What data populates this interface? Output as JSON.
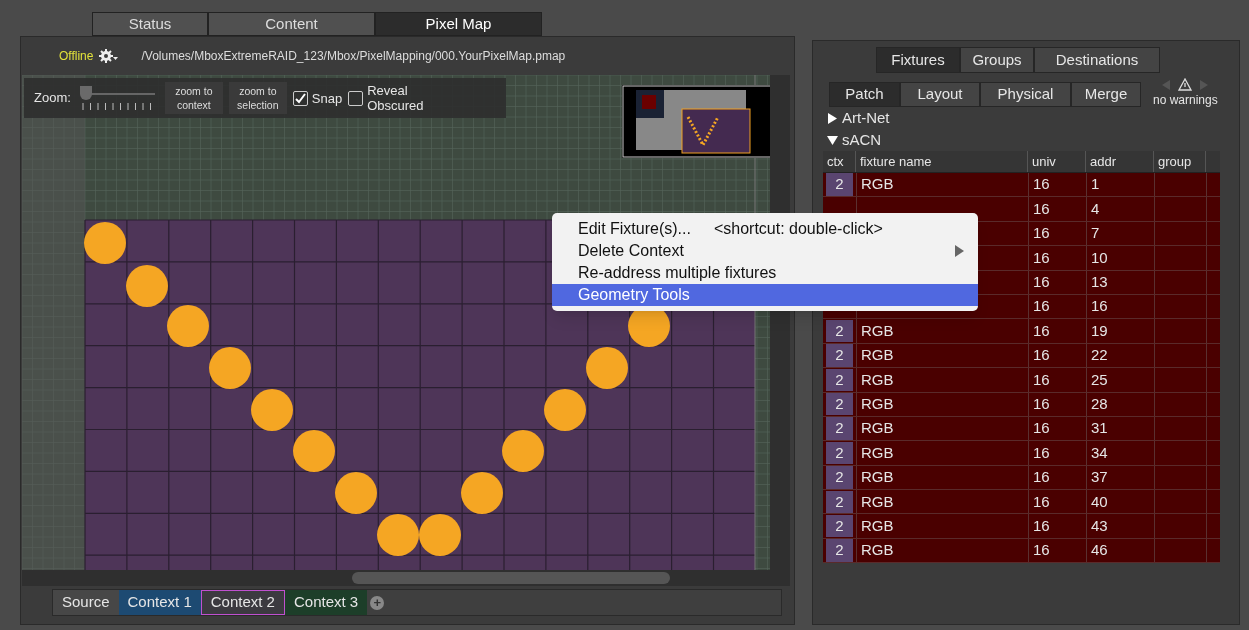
{
  "main_tabs": [
    {
      "label": "Status",
      "selected": false
    },
    {
      "label": "Content",
      "selected": false
    },
    {
      "label": "Pixel Map",
      "selected": true
    }
  ],
  "file_bar": {
    "status": "Offline",
    "path": "/Volumes/MboxExtremeRAID_123/Mbox/PixelMapping/000.YourPixelMap.pmap"
  },
  "zoom_toolbar": {
    "label": "Zoom:",
    "level": 0.05,
    "buttons": [
      "zoom to context",
      "zoom to selection"
    ],
    "checkboxes": [
      {
        "label": "Snap",
        "checked": true
      },
      {
        "label": "Reveal Obscured",
        "checked": false
      }
    ]
  },
  "context_tabs": [
    {
      "label": "Source",
      "color": "#474747",
      "selected": false
    },
    {
      "label": "Context 1",
      "color": "#1d4a72",
      "selected": false
    },
    {
      "label": "Context 2",
      "color": "#3c3a40",
      "selected": true
    },
    {
      "label": "Context 3",
      "color": "#1d3e29",
      "selected": false
    }
  ],
  "add_context_button": "+",
  "panel_tabs": [
    {
      "label": "Fixtures",
      "selected": true
    },
    {
      "label": "Groups",
      "selected": false
    },
    {
      "label": "Destinations",
      "selected": false
    }
  ],
  "sub_tabs": [
    {
      "label": "Patch",
      "selected": true
    },
    {
      "label": "Layout",
      "selected": false
    },
    {
      "label": "Physical",
      "selected": false
    },
    {
      "label": "Merge",
      "selected": false
    }
  ],
  "warnings": {
    "text": "no warnings"
  },
  "protocols": [
    {
      "label": "Art-Net",
      "expanded": false
    },
    {
      "label": "sACN",
      "expanded": true
    }
  ],
  "table": {
    "columns": [
      "ctx",
      "fixture name",
      "univ",
      "addr",
      "group"
    ],
    "rows": [
      {
        "ctx": "2",
        "fixture_name": "RGB",
        "univ": "16",
        "addr": "1"
      },
      {
        "univ": "16",
        "addr": "4"
      },
      {
        "univ": "16",
        "addr": "7"
      },
      {
        "univ": "16",
        "addr": "10"
      },
      {
        "univ": "16",
        "addr": "13"
      },
      {
        "univ": "16",
        "addr": "16"
      },
      {
        "ctx": "2",
        "fixture_name": "RGB",
        "univ": "16",
        "addr": "19"
      },
      {
        "ctx": "2",
        "fixture_name": "RGB",
        "univ": "16",
        "addr": "22"
      },
      {
        "ctx": "2",
        "fixture_name": "RGB",
        "univ": "16",
        "addr": "25"
      },
      {
        "ctx": "2",
        "fixture_name": "RGB",
        "univ": "16",
        "addr": "28"
      },
      {
        "ctx": "2",
        "fixture_name": "RGB",
        "univ": "16",
        "addr": "31"
      },
      {
        "ctx": "2",
        "fixture_name": "RGB",
        "univ": "16",
        "addr": "34"
      },
      {
        "ctx": "2",
        "fixture_name": "RGB",
        "univ": "16",
        "addr": "37"
      },
      {
        "ctx": "2",
        "fixture_name": "RGB",
        "univ": "16",
        "addr": "40"
      },
      {
        "ctx": "2",
        "fixture_name": "RGB",
        "univ": "16",
        "addr": "43"
      },
      {
        "ctx": "2",
        "fixture_name": "RGB",
        "univ": "16",
        "addr": "46"
      }
    ]
  },
  "context_menu": {
    "items": [
      {
        "label": "Edit Fixture(s)...",
        "shortcut": "<shortcut: double-click>",
        "has_submenu": false,
        "selected": false
      },
      {
        "label": "Delete Context",
        "has_submenu": true,
        "selected": false
      },
      {
        "label": "Re-address multiple fixtures",
        "has_submenu": false,
        "selected": false
      },
      {
        "label": "Geometry Tools",
        "has_submenu": false,
        "selected": true
      }
    ]
  }
}
